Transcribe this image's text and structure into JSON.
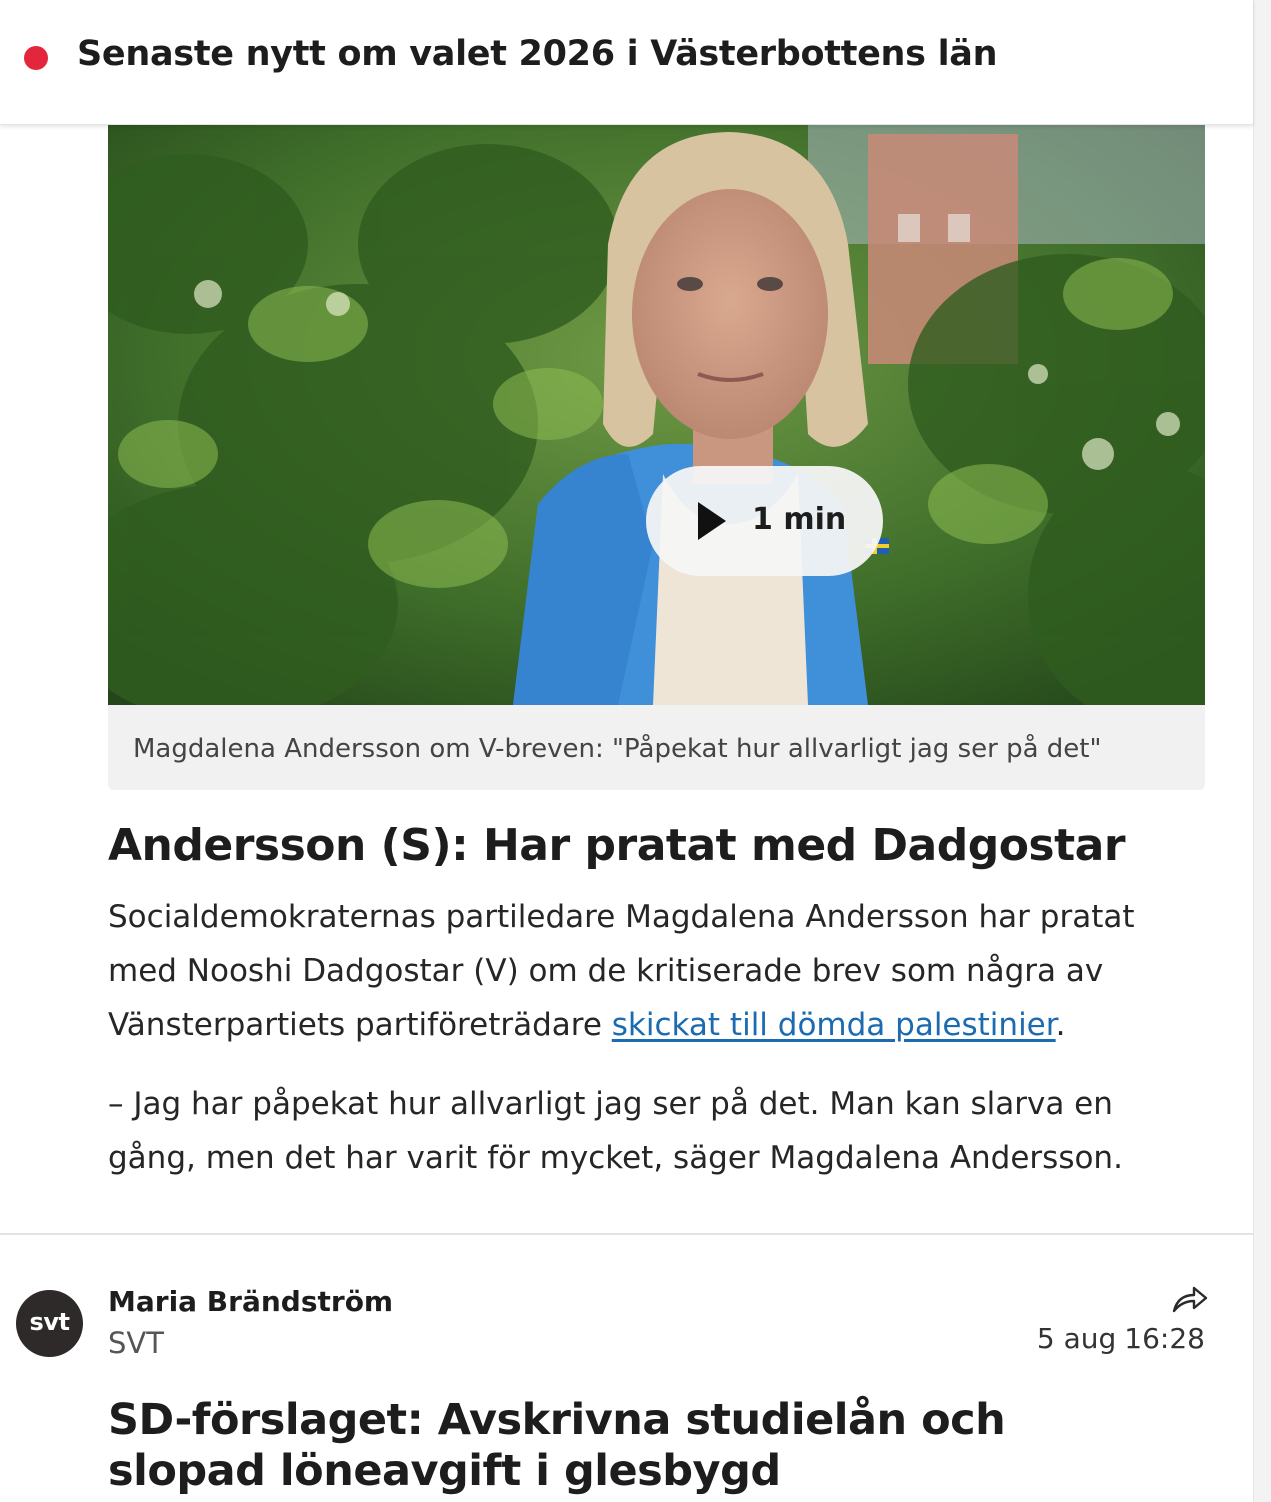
{
  "topbar": {
    "title": "Senaste nytt om valet 2026 i Västerbottens län",
    "live_dot_color": "#e3263b"
  },
  "post1": {
    "video": {
      "duration_label": "1 min",
      "caption": "Magdalena Andersson om V-breven: \"Påpekat hur allvarligt jag ser på det\""
    },
    "headline": "Andersson (S): Har pratat med Dadgostar",
    "paragraph1_before_link": "Socialdemokraternas partiledare Magdalena Andersson har pratat med Nooshi Dadgostar (V) om de kritiserade brev som några av Vänsterpartiets partiföreträdare ",
    "paragraph1_link": "skickat till dömda palestinier",
    "paragraph1_after_link": ".",
    "paragraph2": "– Jag har påpekat hur allvarligt jag ser på det. Man kan slarva en gång, men det har varit för mycket, säger Magdalena Andersson."
  },
  "post2": {
    "avatar_text": "svt",
    "author_name": "Maria Brändström",
    "author_org": "SVT",
    "date": "5 aug",
    "time": "16:28",
    "headline": "SD-förslaget: Avskrivna studielån och slopad löneavgift i glesbygd"
  },
  "colors": {
    "link": "#1c6bb0",
    "text": "#1d1d1d",
    "caption_bg": "#f1f1f1"
  }
}
